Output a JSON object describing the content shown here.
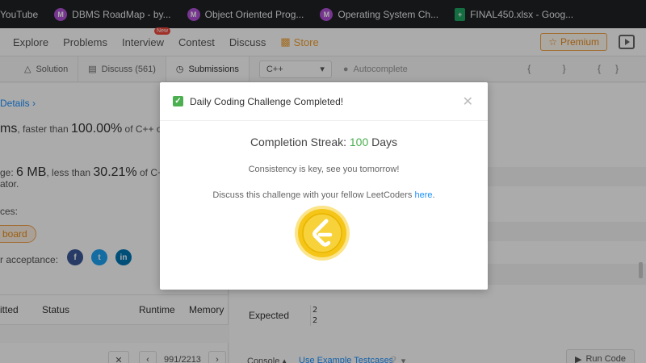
{
  "bookmarks": [
    {
      "label": "YouTube",
      "icon": ""
    },
    {
      "label": "DBMS RoadMap - by...",
      "icon": "M"
    },
    {
      "label": "Object Oriented Prog...",
      "icon": "M"
    },
    {
      "label": "Operating System Ch...",
      "icon": "M"
    },
    {
      "label": "FINAL450.xlsx - Goog...",
      "icon": "sheet"
    }
  ],
  "nav": {
    "explore": "Explore",
    "problems": "Problems",
    "interview": "Interview",
    "new_badge": "New",
    "contest": "Contest",
    "discuss": "Discuss",
    "store": "Store",
    "premium": "Premium"
  },
  "tabs": {
    "solution": "Solution",
    "discuss": "Discuss (561)",
    "submissions": "Submissions",
    "language": "C++",
    "autocomplete": "Autocomplete",
    "icons": "{ }  {}"
  },
  "left": {
    "details": "Details",
    "runtime_prefix": "ms",
    "runtime_mid": ", faster than ",
    "runtime_pct": "100.00%",
    "runtime_suffix": " of C++ onlin",
    "memory_prefix": "ge: ",
    "memory_value": "6 MB",
    "memory_mid": ", less than ",
    "memory_pct": "30.21%",
    "memory_suffix": " of C++ o",
    "ator": "ator.",
    "ces": "ces:",
    "board": "board",
    "acceptance": "r acceptance:",
    "table": {
      "submitted": "itted",
      "status": "Status",
      "runtime": "Runtime",
      "memory": "Memory"
    },
    "pager": {
      "current": "991/2213"
    }
  },
  "right": {
    "expected": "Expected",
    "expected_values": [
      "2",
      "2"
    ],
    "console": "Console",
    "example": "Use Example Testcases",
    "run": "Run Code"
  },
  "modal": {
    "title": "Daily Coding Challenge Completed!",
    "streak_label": "Completion Streak: ",
    "streak_value": "100",
    "streak_unit": " Days",
    "consistency": "Consistency is key, see you tomorrow!",
    "discuss_text": "Discuss this challenge with your fellow LeetCoders ",
    "discuss_link": "here",
    "discuss_end": "."
  },
  "colors": {
    "accent": "#1a90ff",
    "success": "#4caf50",
    "premium": "#e88c1c",
    "coin": "#f5c518"
  }
}
